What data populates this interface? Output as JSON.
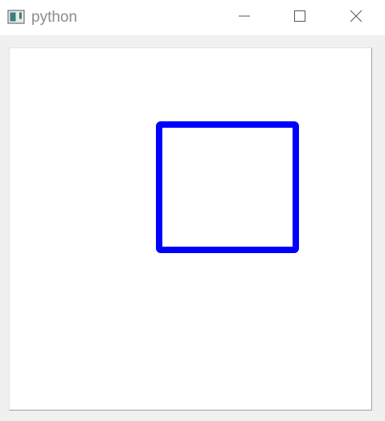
{
  "window": {
    "title": "python",
    "controls": {
      "minimize": "minimize",
      "maximize": "maximize",
      "close": "close"
    }
  },
  "canvas": {
    "background": "#ffffff",
    "shapes": [
      {
        "type": "square-outline",
        "stroke_color": "#0000ff"
      }
    ]
  },
  "icons": {
    "app": "python-window-icon",
    "minimize": "minimize-icon",
    "maximize": "maximize-icon",
    "close": "close-icon"
  }
}
